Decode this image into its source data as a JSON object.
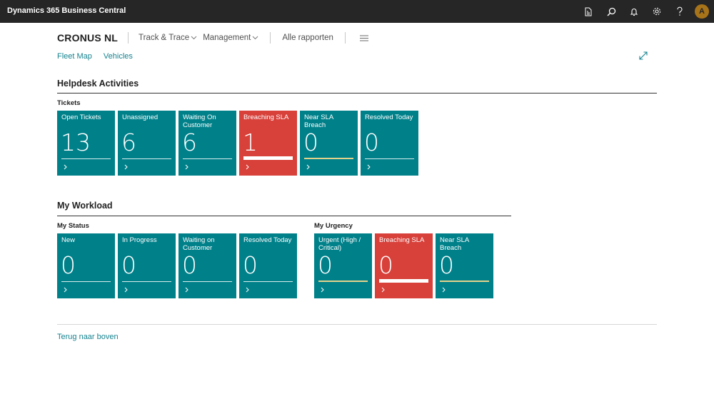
{
  "app": {
    "title": "Dynamics 365 Business Central",
    "user_initial": "A",
    "header_icons": [
      "document-icon",
      "search-icon",
      "bell-icon",
      "gear-icon",
      "help-icon"
    ]
  },
  "nav": {
    "company": "CRONUS NL",
    "items": [
      {
        "label": "Track & Trace",
        "dropdown": true
      },
      {
        "label": "Management",
        "dropdown": true
      },
      {
        "label": "Alle rapporten",
        "dropdown": false
      }
    ]
  },
  "actions": [
    "Fleet Map",
    "Vehicles"
  ],
  "helpdesk": {
    "title": "Helpdesk Activities",
    "group": "Tickets",
    "tiles": [
      {
        "label": "Open Tickets",
        "value": "13",
        "style": "normal"
      },
      {
        "label": "Unassigned",
        "value": "6",
        "style": "normal"
      },
      {
        "label": "Waiting On Customer",
        "value": "6",
        "style": "normal"
      },
      {
        "label": "Breaching SLA",
        "value": "1",
        "style": "alert"
      },
      {
        "label": "Near SLA Breach",
        "value": "0",
        "style": "warning"
      },
      {
        "label": "Resolved Today",
        "value": "0",
        "style": "normal"
      }
    ]
  },
  "workload": {
    "title": "My Workload",
    "status": {
      "group": "My Status",
      "tiles": [
        {
          "label": "New",
          "value": "0",
          "style": "normal"
        },
        {
          "label": "In Progress",
          "value": "0",
          "style": "normal"
        },
        {
          "label": "Waiting on Customer",
          "value": "0",
          "style": "normal"
        },
        {
          "label": "Resolved Today",
          "value": "0",
          "style": "normal"
        }
      ]
    },
    "urgency": {
      "group": "My Urgency",
      "tiles": [
        {
          "label": "Urgent (High / Critical)",
          "value": "0",
          "style": "warning"
        },
        {
          "label": "Breaching SLA",
          "value": "0",
          "style": "alert"
        },
        {
          "label": "Near SLA Breach",
          "value": "0",
          "style": "warning"
        }
      ]
    }
  },
  "footer": {
    "back_to_top": "Terug naar boven"
  },
  "colors": {
    "tile": "#00818a",
    "alert": "#d8403a",
    "warning_bar": "#e3d38a",
    "link": "#16838f",
    "appbar": "#262626"
  }
}
